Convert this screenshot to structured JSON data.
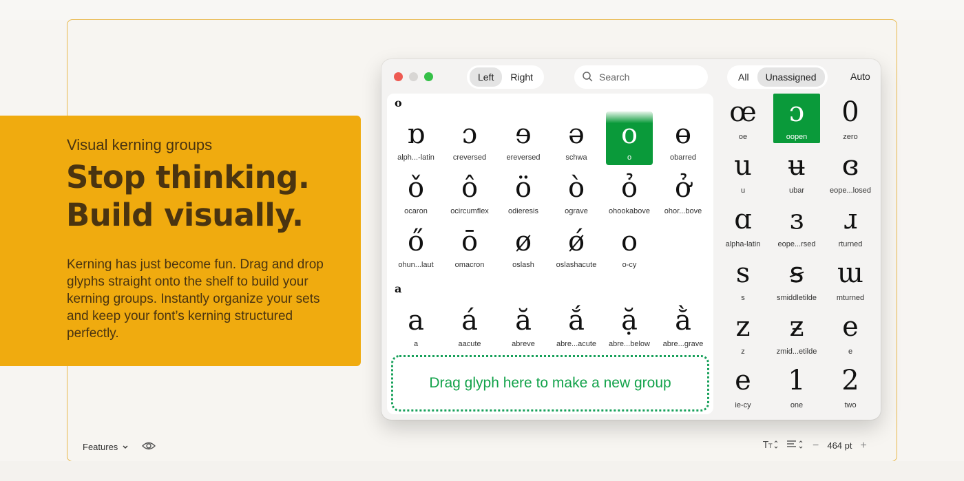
{
  "promo": {
    "eyebrow": "Visual kerning groups",
    "headline_line1": "Stop thinking.",
    "headline_line2": "Build visually.",
    "body": "Kerning has just become fun. Drag and drop glyphs straight onto the shelf to build your kerning groups. Instantly organize your sets and keep your font’s kerning structured perfectly.",
    "accent_color": "#f0ab0f"
  },
  "window": {
    "side_tabs": [
      "Left",
      "Right"
    ],
    "side_selected": "Left",
    "search_placeholder": "Search",
    "filter_tabs": [
      "All",
      "Unassigned"
    ],
    "filter_selected": "Unassigned",
    "auto_label": "Auto"
  },
  "groups": [
    {
      "label": "o",
      "glyphs": [
        {
          "char": "ɒ",
          "name": "alph...-latin"
        },
        {
          "char": "ɔ",
          "name": "creversed"
        },
        {
          "char": "ɘ",
          "name": "ereversed"
        },
        {
          "char": "ə",
          "name": "schwa"
        },
        {
          "char": "o",
          "name": "o",
          "selected": true
        },
        {
          "char": "ɵ",
          "name": "obarred"
        },
        {
          "char": "ǒ",
          "name": "ocaron"
        },
        {
          "char": "ô",
          "name": "ocircumflex"
        },
        {
          "char": "ö",
          "name": "odieresis"
        },
        {
          "char": "ò",
          "name": "ograve"
        },
        {
          "char": "ỏ",
          "name": "ohookabove"
        },
        {
          "char": "ở",
          "name": "ohor...bove"
        },
        {
          "char": "ő",
          "name": "ohun...laut"
        },
        {
          "char": "ō",
          "name": "omacron"
        },
        {
          "char": "ø",
          "name": "oslash"
        },
        {
          "char": "ǿ",
          "name": "oslashacute"
        },
        {
          "char": "о",
          "name": "o-cy"
        }
      ]
    },
    {
      "label": "a",
      "glyphs": [
        {
          "char": "a",
          "name": "a"
        },
        {
          "char": "á",
          "name": "aacute"
        },
        {
          "char": "ă",
          "name": "abreve"
        },
        {
          "char": "ắ",
          "name": "abre...acute"
        },
        {
          "char": "ặ",
          "name": "abre...below"
        },
        {
          "char": "ằ",
          "name": "abre...grave"
        }
      ]
    }
  ],
  "dropzone_text": "Drag glyph here to make a new group",
  "unassigned": [
    {
      "char": "œ",
      "name": "oe"
    },
    {
      "char": "ɔ",
      "name": "oopen",
      "selected": true
    },
    {
      "char": "0",
      "name": "zero"
    },
    {
      "char": "u",
      "name": "u"
    },
    {
      "char": "ʉ",
      "name": "ubar"
    },
    {
      "char": "ɞ",
      "name": "eope...losed"
    },
    {
      "char": "ɑ",
      "name": "alpha-latin"
    },
    {
      "char": "ɜ",
      "name": "eope...rsed"
    },
    {
      "char": "ɹ",
      "name": "rturned"
    },
    {
      "char": "s",
      "name": "s"
    },
    {
      "char": "ꞩ",
      "name": "smiddletilde"
    },
    {
      "char": "ɯ",
      "name": "mturned"
    },
    {
      "char": "z",
      "name": "z"
    },
    {
      "char": "ƶ",
      "name": "zmid...etilde"
    },
    {
      "char": "e",
      "name": "e"
    },
    {
      "char": "е",
      "name": "ie-cy"
    },
    {
      "char": "1",
      "name": "one"
    },
    {
      "char": "2",
      "name": "two"
    }
  ],
  "footer": {
    "features_label": "Features",
    "size_value": "464 pt",
    "minus": "−",
    "plus": "+"
  }
}
